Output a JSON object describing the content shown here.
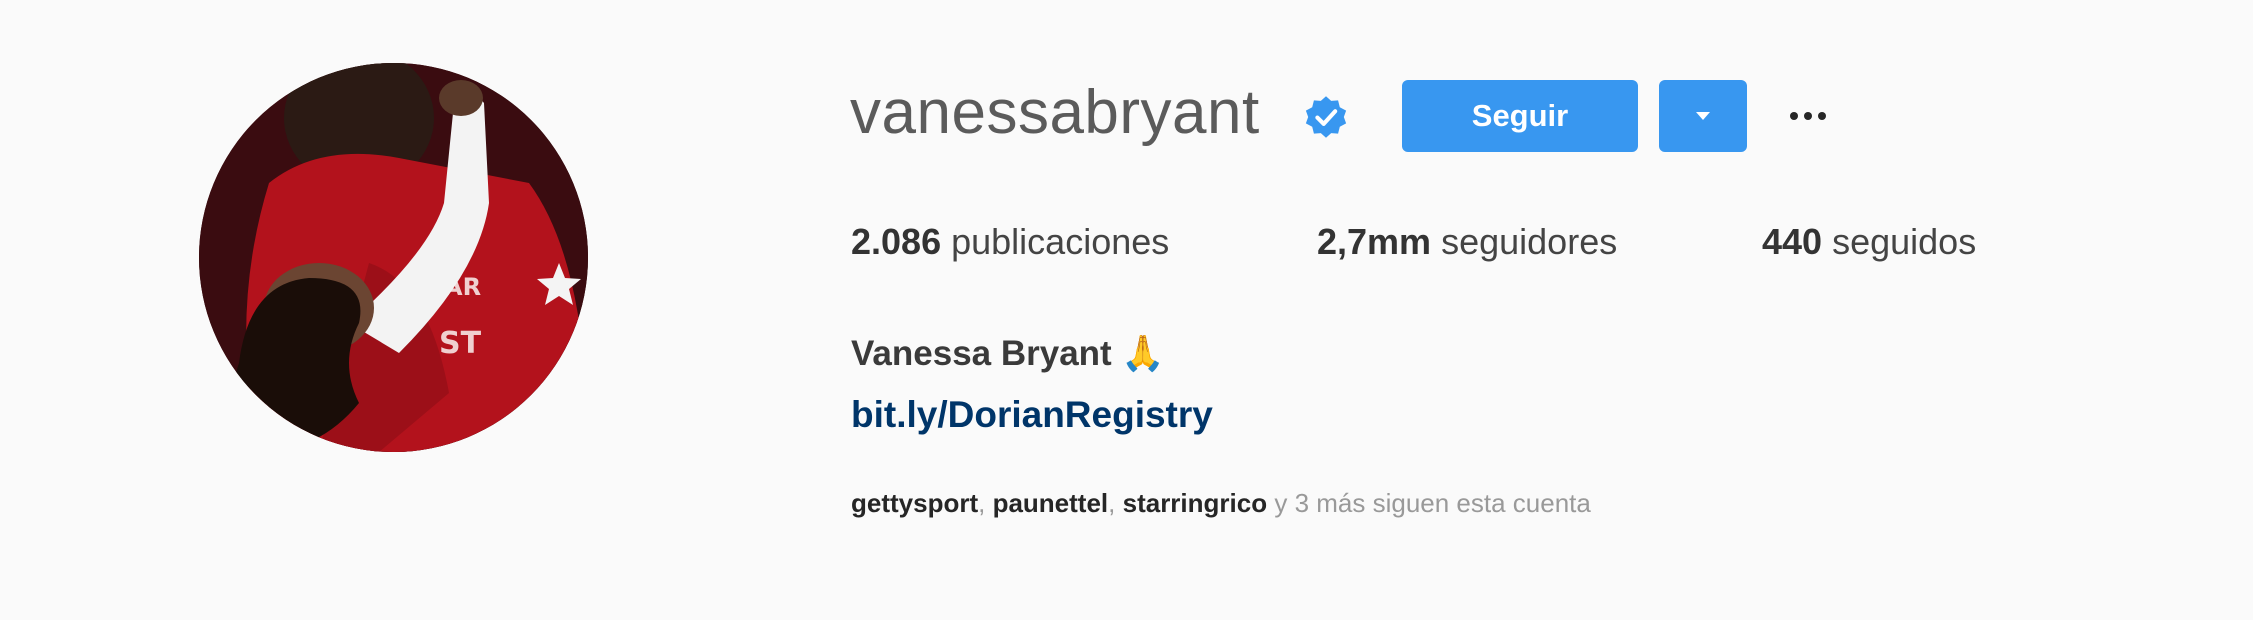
{
  "profile": {
    "username": "vanessabryant",
    "full_name": "Vanessa Bryant 🙏",
    "link": "bit.ly/DorianRegistry",
    "verified": true
  },
  "actions": {
    "follow_label": "Seguir",
    "dropdown_icon": "chevron-down-icon",
    "options_icon": "more-options-icon"
  },
  "stats": {
    "posts_count": "2.086",
    "posts_label": "publicaciones",
    "followers_count": "2,7mm",
    "followers_label": "seguidores",
    "following_count": "440",
    "following_label": "seguidos"
  },
  "followed_by": {
    "accounts": [
      "gettysport",
      "paunettel",
      "starringrico"
    ],
    "separator": ", ",
    "suffix": "y 3 más siguen esta cuenta"
  },
  "colors": {
    "accent": "#3897f0",
    "link": "#003569",
    "background": "#fafafa"
  }
}
